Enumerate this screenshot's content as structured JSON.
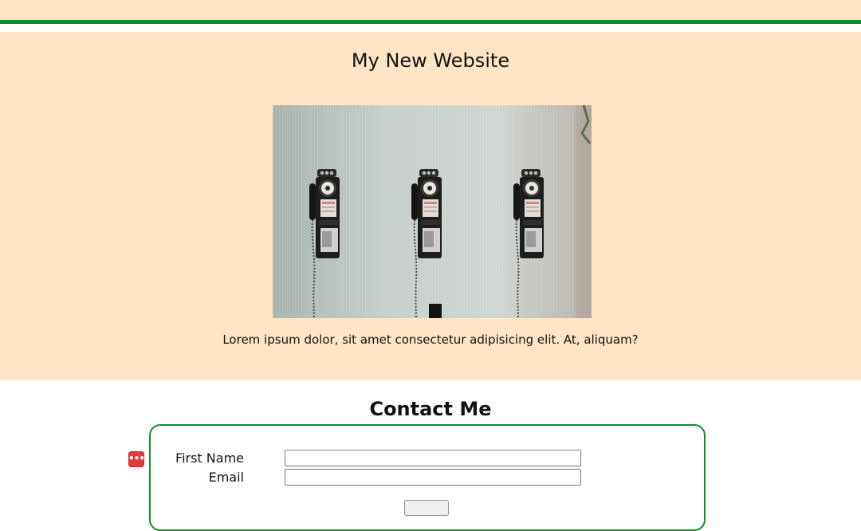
{
  "header": {
    "site_title": "My New Website"
  },
  "hero": {
    "image_alt": "Three vintage rotary payphones mounted on a wall",
    "caption": "Lorem ipsum dolor, sit amet consectetur adipisicing elit. At, aliquam?"
  },
  "contact": {
    "title": "Contact Me",
    "first_name_label": "First Name",
    "email_label": "Email",
    "first_name_value": "",
    "email_value": "",
    "submit_label": ""
  },
  "extension_badge": {
    "icon": "password-manager-icon",
    "glyph": "•••|"
  },
  "colors": {
    "hero_background": "#ffe4c5",
    "accent_green": "#0e8a2c",
    "form_border": "#198a33",
    "badge_red": "#e0393e"
  }
}
